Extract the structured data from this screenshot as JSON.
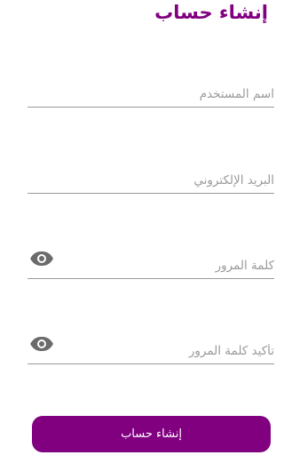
{
  "header": {
    "title": "إنشاء حساب"
  },
  "form": {
    "username": {
      "placeholder": "اسم المستخدم",
      "value": ""
    },
    "email": {
      "placeholder": "البريد الإلكتروني",
      "value": ""
    },
    "password": {
      "placeholder": "كلمة المرور",
      "value": ""
    },
    "confirm_password": {
      "placeholder": "تأكيد كلمة المرور",
      "value": ""
    }
  },
  "actions": {
    "submit_label": "إنشاء حساب"
  },
  "icons": {
    "password_toggle": "eye-icon"
  },
  "colors": {
    "accent": "#800080",
    "underline": "#9b9b9b",
    "placeholder": "#9a9a9a",
    "icon": "#6b6b6b"
  }
}
